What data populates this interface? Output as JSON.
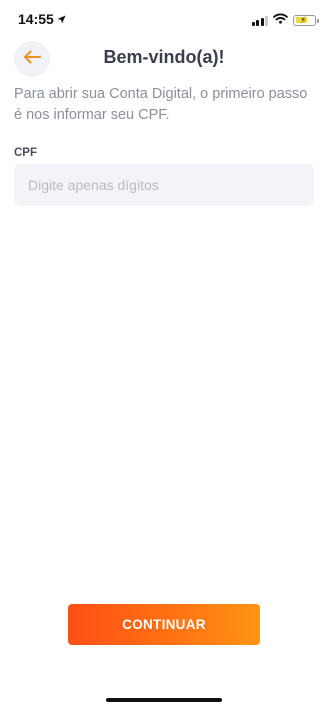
{
  "status_bar": {
    "time": "14:55",
    "icons": [
      "location-arrow-icon",
      "cellular-signal-icon",
      "wifi-icon",
      "battery-charging-icon"
    ],
    "battery_color": "#f0d73a"
  },
  "header": {
    "back_icon": "arrow-left-icon",
    "title": "Bem-vindo(a)!"
  },
  "main": {
    "intro_text": "Para abrir sua Conta Digital, o primeiro passo é nos informar seu CPF.",
    "cpf_field": {
      "label": "CPF",
      "value": "",
      "placeholder": "Digite apenas dígitos"
    },
    "continue_label": "CONTINUAR"
  },
  "colors": {
    "accent": "#ff7212",
    "accent_gradient_start": "#ff4f17",
    "accent_gradient_end": "#ff9416",
    "back_arrow": "#e8921f"
  }
}
